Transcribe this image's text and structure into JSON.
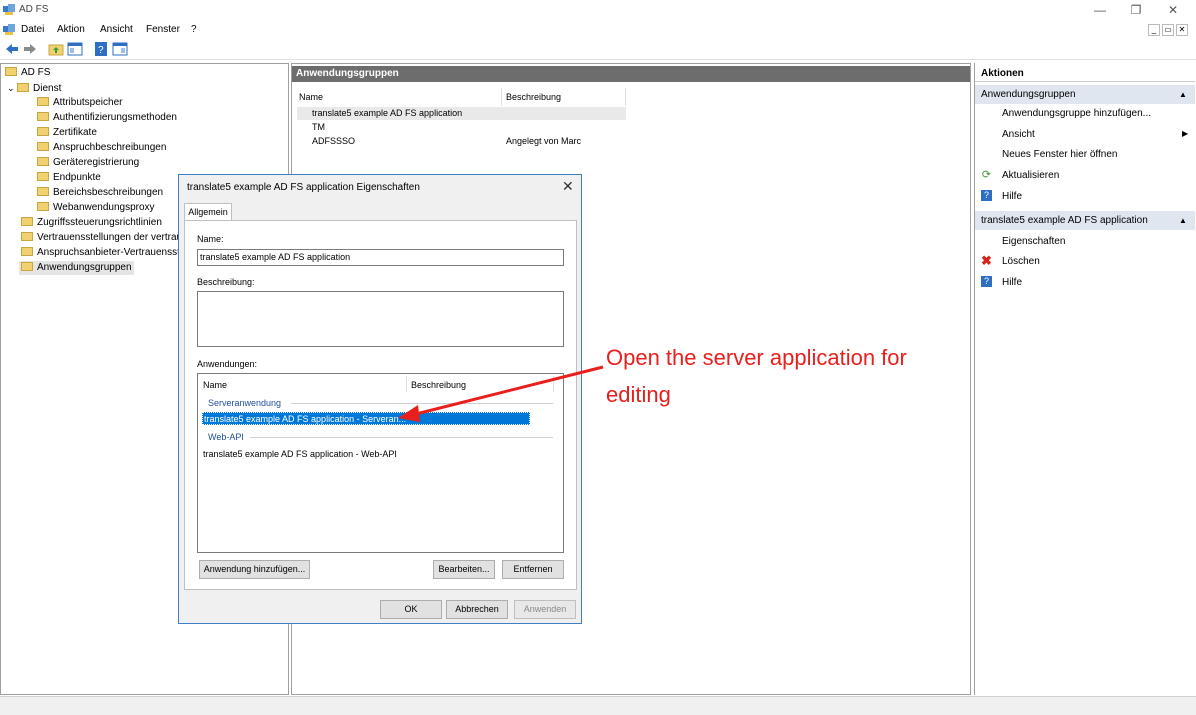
{
  "window": {
    "title": "AD FS"
  },
  "menu": {
    "items": [
      "Datei",
      "Aktion",
      "Ansicht",
      "Fenster",
      "?"
    ]
  },
  "tree": {
    "root": "AD FS",
    "dienst": "Dienst",
    "dienst_children": [
      "Attributspeicher",
      "Authentifizierungsmethoden",
      "Zertifikate",
      "Anspruchbeschreibungen",
      "Geräteregistrierung",
      "Endpunkte",
      "Bereichsbeschreibungen",
      "Webanwendungsproxy"
    ],
    "others": [
      "Zugriffssteuerungsrichtlinien",
      "Vertrauensstellungen der vertrau",
      "Anspruchsanbieter-Vertrauensste",
      "Anwendungsgruppen"
    ]
  },
  "center": {
    "title": "Anwendungsgruppen",
    "columns": [
      "Name",
      "Beschreibung"
    ],
    "rows": [
      {
        "name": "translate5 example AD FS application",
        "desc": ""
      },
      {
        "name": "TM",
        "desc": ""
      },
      {
        "name": "ADFSSSO",
        "desc": "Angelegt von Marc"
      }
    ]
  },
  "actions": {
    "title": "Aktionen",
    "section1": "Anwendungsgruppen",
    "section1_items": [
      "Anwendungsgruppe hinzufügen...",
      "Ansicht",
      "Neues Fenster hier öffnen",
      "Aktualisieren",
      "Hilfe"
    ],
    "section2": "translate5 example AD FS application",
    "section2_items": [
      "Eigenschaften",
      "Löschen",
      "Hilfe"
    ]
  },
  "dialog": {
    "title": "translate5 example AD FS application Eigenschaften",
    "tab": "Allgemein",
    "name_label": "Name:",
    "name_value": "translate5 example AD FS application",
    "desc_label": "Beschreibung:",
    "apps_label": "Anwendungen:",
    "apps_columns": [
      "Name",
      "Beschreibung"
    ],
    "group1": "Serveranwendung",
    "group1_item": "translate5 example AD FS application - Serveran...",
    "group2": "Web-API",
    "group2_item": "translate5 example AD FS application - Web-API",
    "btn_add": "Anwendung hinzufügen...",
    "btn_edit": "Bearbeiten...",
    "btn_remove": "Entfernen",
    "btn_ok": "OK",
    "btn_cancel": "Abbrechen",
    "btn_apply": "Anwenden"
  },
  "annotation": {
    "line1": "Open the server application for",
    "line2": "editing"
  },
  "colors": {
    "annotation": "#e8201d",
    "selection": "#0078d7",
    "header_bg": "#6d6d6d"
  }
}
